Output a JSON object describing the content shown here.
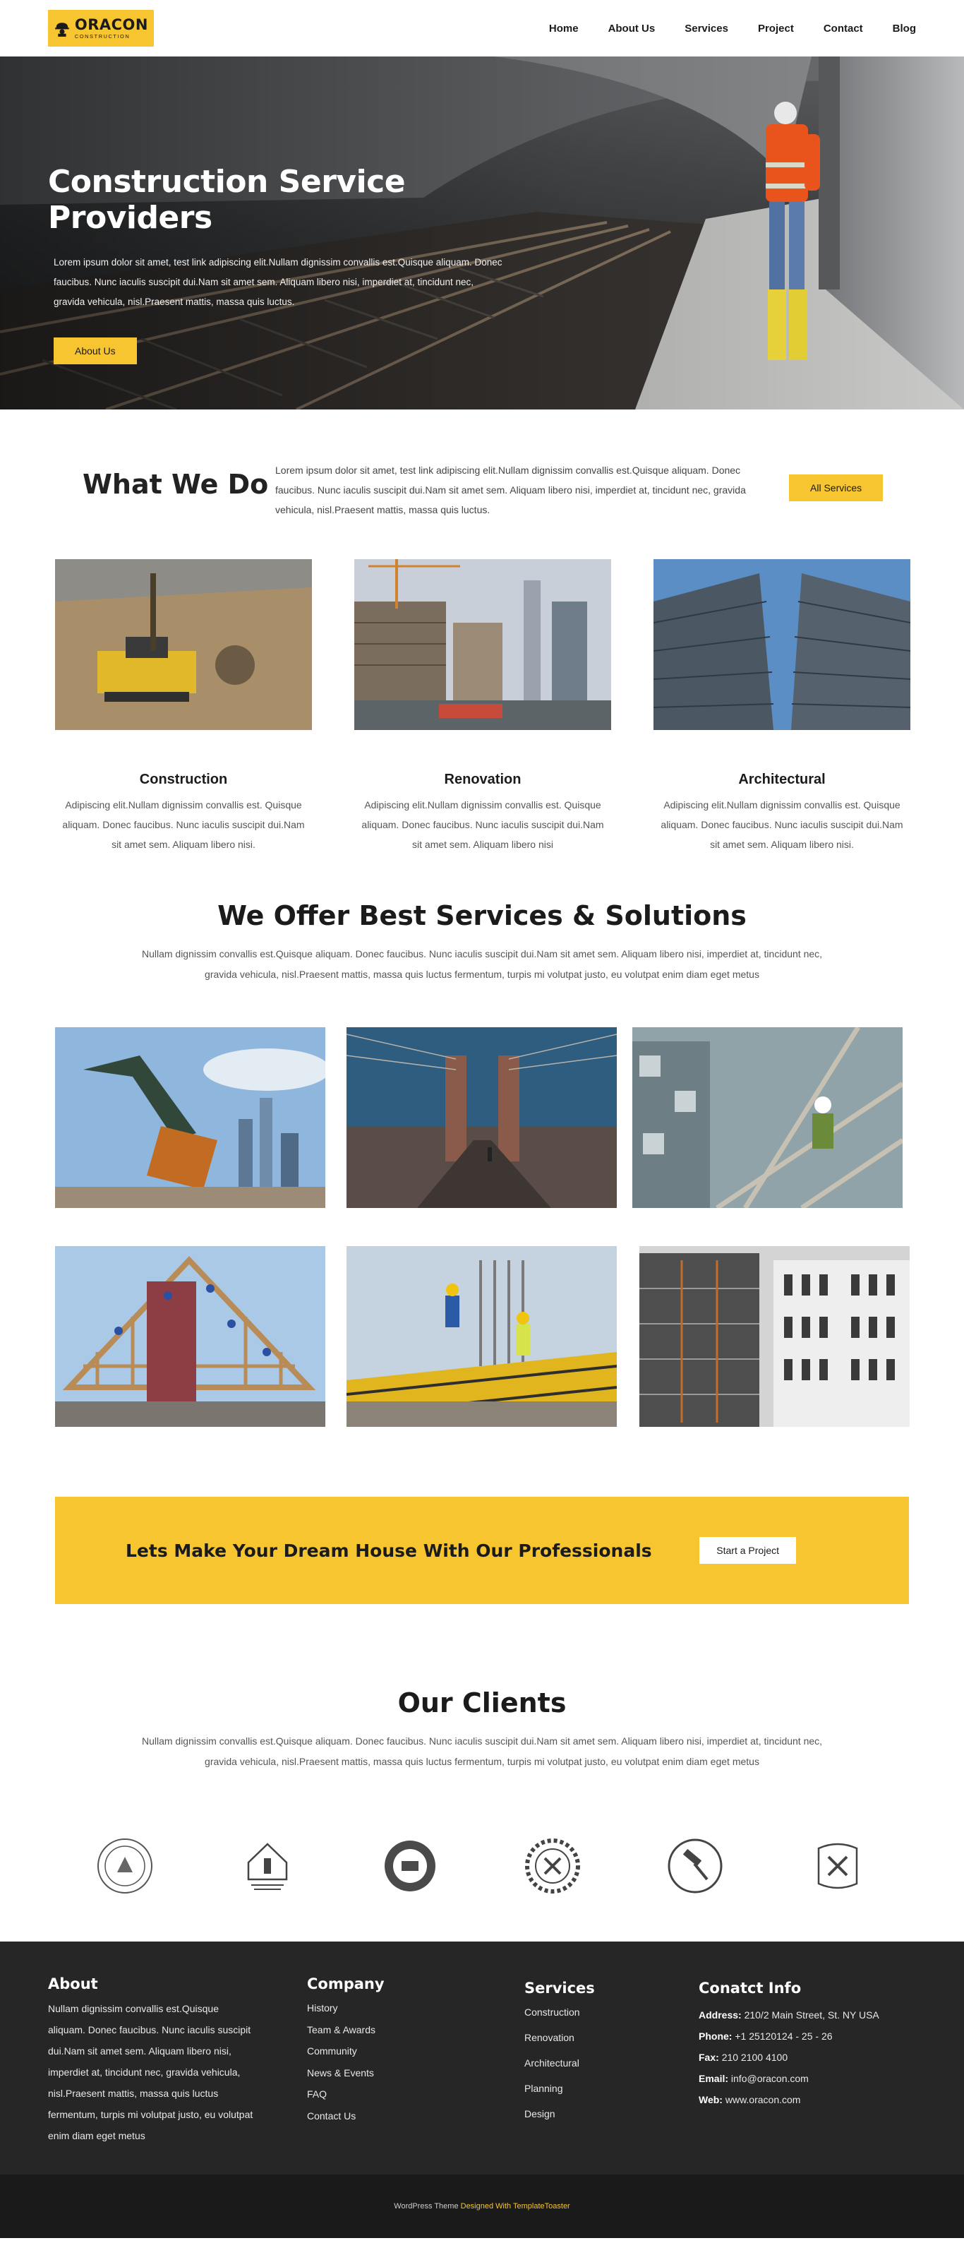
{
  "header": {
    "logo_title": "ORACON",
    "logo_sub": "CONSTRUCTION",
    "nav": [
      "Home",
      "About Us",
      "Services",
      "Project",
      "Contact",
      "Blog"
    ]
  },
  "hero": {
    "title": "Construction Service Providers",
    "text": "Lorem ipsum dolor sit amet, test link adipiscing elit.Nullam dignissim convallis est.Quisque aliquam. Donec faucibus. Nunc iaculis suscipit dui.Nam sit amet sem. Aliquam libero nisi, imperdiet at, tincidunt nec, gravida vehicula, nisl.Praesent mattis, massa quis luctus.",
    "button": "About Us"
  },
  "what_we_do": {
    "title": "What We Do",
    "text": "Lorem ipsum dolor sit amet, test link adipiscing elit.Nullam dignissim convallis est.Quisque aliquam. Donec faucibus. Nunc iaculis suscipit dui.Nam sit amet sem. Aliquam libero nisi, imperdiet at, tincidunt nec, gravida vehicula, nisl.Praesent mattis, massa quis luctus.",
    "button": "All Services",
    "cards": [
      {
        "title": "Construction",
        "text": "Adipiscing elit.Nullam dignissim convallis est. Quisque aliquam. Donec faucibus. Nunc iaculis suscipit dui.Nam sit amet sem. Aliquam libero nisi."
      },
      {
        "title": "Renovation",
        "text": "Adipiscing elit.Nullam dignissim convallis est. Quisque aliquam. Donec faucibus. Nunc iaculis suscipit dui.Nam sit amet sem. Aliquam libero nisi"
      },
      {
        "title": "Architectural",
        "text": "Adipiscing elit.Nullam dignissim convallis est. Quisque aliquam. Donec faucibus. Nunc iaculis suscipit dui.Nam sit amet sem. Aliquam libero nisi."
      }
    ]
  },
  "services": {
    "title": "We Offer Best Services & Solutions",
    "text": "Nullam dignissim convallis est.Quisque aliquam. Donec faucibus. Nunc iaculis suscipit dui.Nam sit amet sem. Aliquam libero nisi, imperdiet at, tincidunt nec, gravida vehicula, nisl.Praesent mattis, massa quis luctus fermentum, turpis mi volutpat justo, eu volutpat enim diam eget metus"
  },
  "cta": {
    "text": "Lets Make Your Dream House With Our Professionals",
    "button": "Start a Project"
  },
  "clients": {
    "title": "Our Clients",
    "text": "Nullam dignissim convallis est.Quisque aliquam. Donec faucibus. Nunc iaculis suscipit dui.Nam sit amet sem. Aliquam libero nisi, imperdiet at, tincidunt nec, gravida vehicula, nisl.Praesent mattis, massa quis luctus fermentum, turpis mi volutpat justo, eu volutpat enim diam eget metus"
  },
  "footer": {
    "about_title": "About",
    "about_text": "Nullam dignissim convallis est.Quisque aliquam. Donec faucibus. Nunc iaculis suscipit dui.Nam sit amet sem. Aliquam libero nisi, imperdiet at, tincidunt nec, gravida vehicula, nisl.Praesent mattis, massa quis luctus fermentum, turpis mi volutpat justo, eu volutpat enim diam eget metus",
    "company_title": "Company",
    "company_links": [
      "History",
      "Team & Awards",
      "Community",
      "News & Events",
      "FAQ",
      "Contact Us"
    ],
    "services_title": "Services",
    "services_links": [
      "Construction",
      "Renovation",
      "Architectural",
      "Planning",
      "Design"
    ],
    "contact_title": "Conatct Info",
    "contact": {
      "address_label": "Address:",
      "address": "210/2 Main Street, St. NY  USA",
      "phone_label": "Phone:",
      "phone": "+1 25120124 - 25 - 26",
      "fax_label": "Fax:",
      "fax": "210 2100 4100",
      "email_label": "Email:",
      "email": "info@oracon.com",
      "web_label": "Web:",
      "web": "www.oracon.com"
    }
  },
  "bottom": {
    "text": "WordPress Theme",
    "link": "Designed With TemplateToaster"
  },
  "colors": {
    "accent": "#f7c52f",
    "footer_bg": "#262626",
    "bottom_bg": "#1a1a1a"
  }
}
